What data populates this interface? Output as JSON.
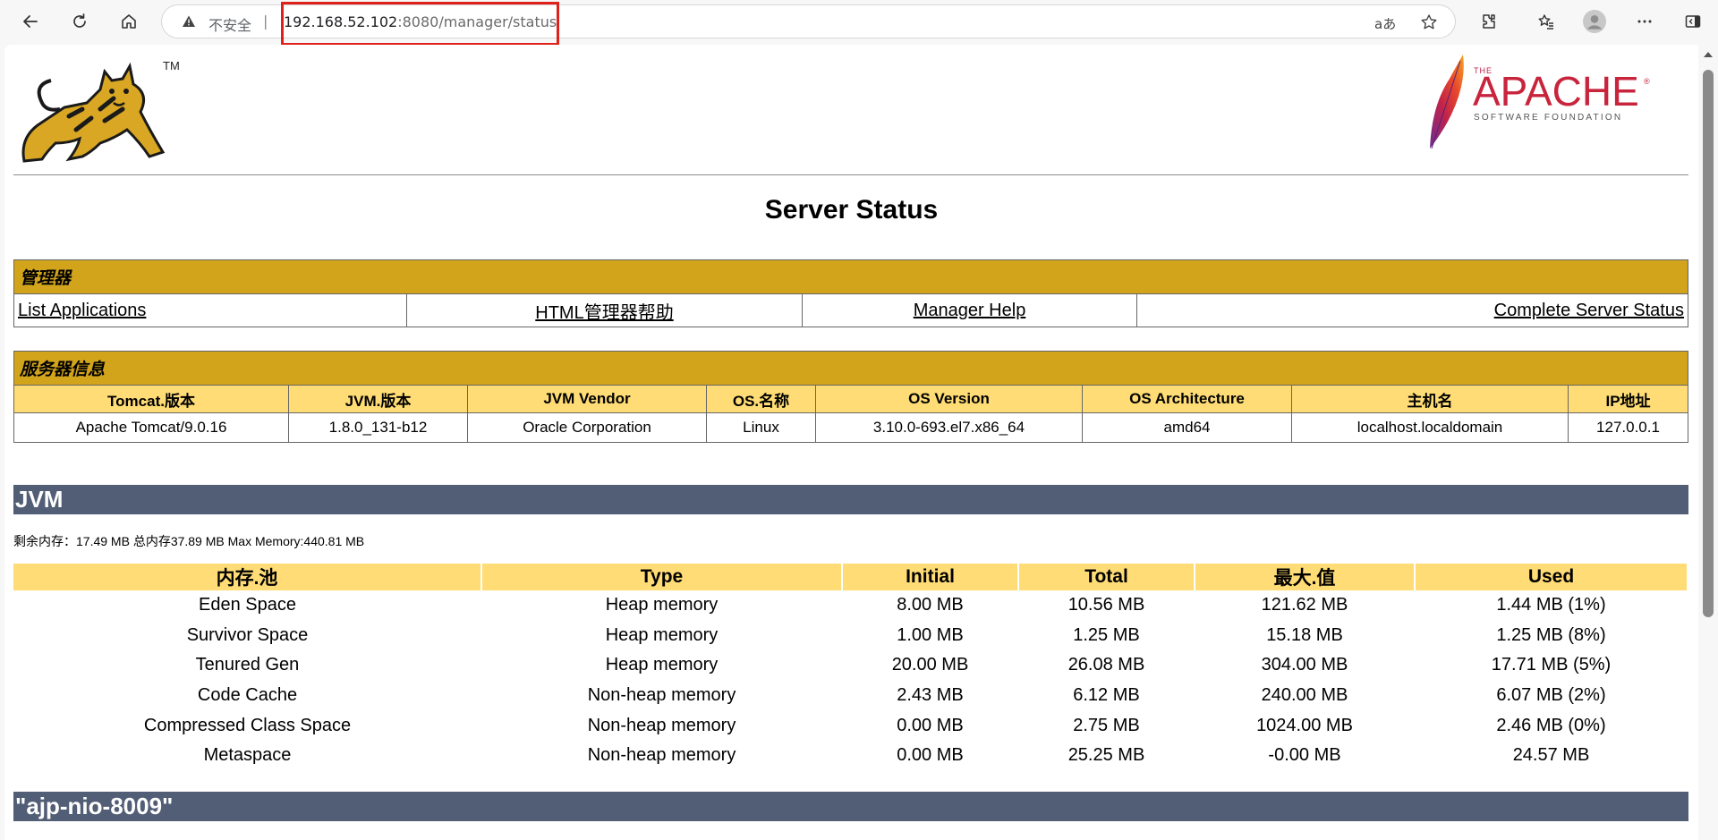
{
  "browser": {
    "insecure_label": "不安全",
    "separator": "|",
    "url_host": "192.168.52.102",
    "url_rest": ":8080/manager/status",
    "translate_label": "aあ"
  },
  "logos": {
    "tomcat_tm": "TM",
    "apache_the": "THE",
    "apache_name": "APACHE",
    "apache_reg": "®",
    "apache_sub": "SOFTWARE FOUNDATION"
  },
  "page": {
    "title": "Server Status"
  },
  "manager": {
    "heading": "管理器",
    "links": [
      "List Applications",
      "HTML管理器帮助",
      "Manager Help",
      "Complete Server Status"
    ]
  },
  "server_info": {
    "heading": "服务器信息",
    "headers": [
      "Tomcat.版本",
      "JVM.版本",
      "JVM Vendor",
      "OS.名称",
      "OS Version",
      "OS Architecture",
      "主机名",
      "IP地址"
    ],
    "values": [
      "Apache Tomcat/9.0.16",
      "1.8.0_131-b12",
      "Oracle Corporation",
      "Linux",
      "3.10.0-693.el7.x86_64",
      "amd64",
      "localhost.localdomain",
      "127.0.0.1"
    ]
  },
  "jvm": {
    "heading": "JVM",
    "memory_summary": "剩余内存：17.49 MB 总内存37.89 MB Max Memory:440.81 MB",
    "headers": [
      "内存.池",
      "Type",
      "Initial",
      "Total",
      "最大.值",
      "Used"
    ],
    "rows": [
      [
        "Eden Space",
        "Heap memory",
        "8.00 MB",
        "10.56 MB",
        "121.62 MB",
        "1.44 MB (1%)"
      ],
      [
        "Survivor Space",
        "Heap memory",
        "1.00 MB",
        "1.25 MB",
        "15.18 MB",
        "1.25 MB (8%)"
      ],
      [
        "Tenured Gen",
        "Heap memory",
        "20.00 MB",
        "26.08 MB",
        "304.00 MB",
        "17.71 MB (5%)"
      ],
      [
        "Code Cache",
        "Non-heap memory",
        "2.43 MB",
        "6.12 MB",
        "240.00 MB",
        "6.07 MB (2%)"
      ],
      [
        "Compressed Class Space",
        "Non-heap memory",
        "0.00 MB",
        "2.75 MB",
        "1024.00 MB",
        "2.46 MB (0%)"
      ],
      [
        "Metaspace",
        "Non-heap memory",
        "0.00 MB",
        "25.25 MB",
        "-0.00 MB",
        "24.57 MB"
      ]
    ]
  },
  "connector": {
    "heading": "\"ajp-nio-8009\""
  },
  "colors": {
    "section_gold": "#d2a41c",
    "header_yellow": "#ffdc75",
    "bar_slate": "#525d76",
    "highlight_red": "#e0201a"
  },
  "icons": [
    "back-icon",
    "refresh-icon",
    "home-icon",
    "warning-icon",
    "translate-icon",
    "favorite-star-icon",
    "extensions-icon",
    "favorites-list-icon",
    "profile-avatar-icon",
    "more-icon",
    "sidebar-icon"
  ]
}
